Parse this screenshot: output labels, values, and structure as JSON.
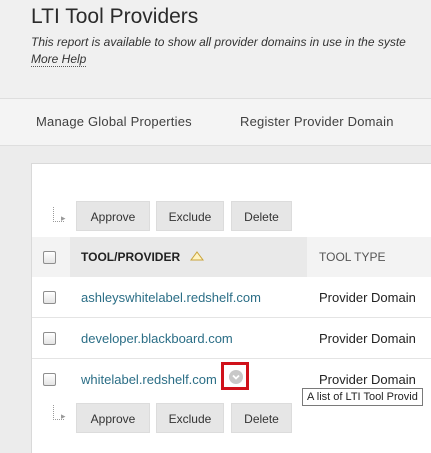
{
  "page": {
    "title": "LTI Tool Providers",
    "description": "This report is available to show all provider domains in use in the syste",
    "more_help": "More Help"
  },
  "action_bar": {
    "manage_global_properties": "Manage Global Properties",
    "register_provider_domain": "Register Provider Domain"
  },
  "buttons": {
    "approve": "Approve",
    "exclude": "Exclude",
    "delete": "Delete"
  },
  "table": {
    "columns": [
      "TOOL/PROVIDER",
      "TOOL TYPE"
    ],
    "rows": [
      {
        "provider": "ashleyswhitelabel.redshelf.com",
        "type": "Provider Domain"
      },
      {
        "provider": "developer.blackboard.com",
        "type": "Provider Domain"
      },
      {
        "provider": "whitelabel.redshelf.com",
        "type": "Provider Domain"
      }
    ]
  },
  "tooltip": {
    "text": "A list of LTI Tool Provid"
  },
  "colors": {
    "link": "#2b6e86",
    "highlight": "#d0111a"
  }
}
